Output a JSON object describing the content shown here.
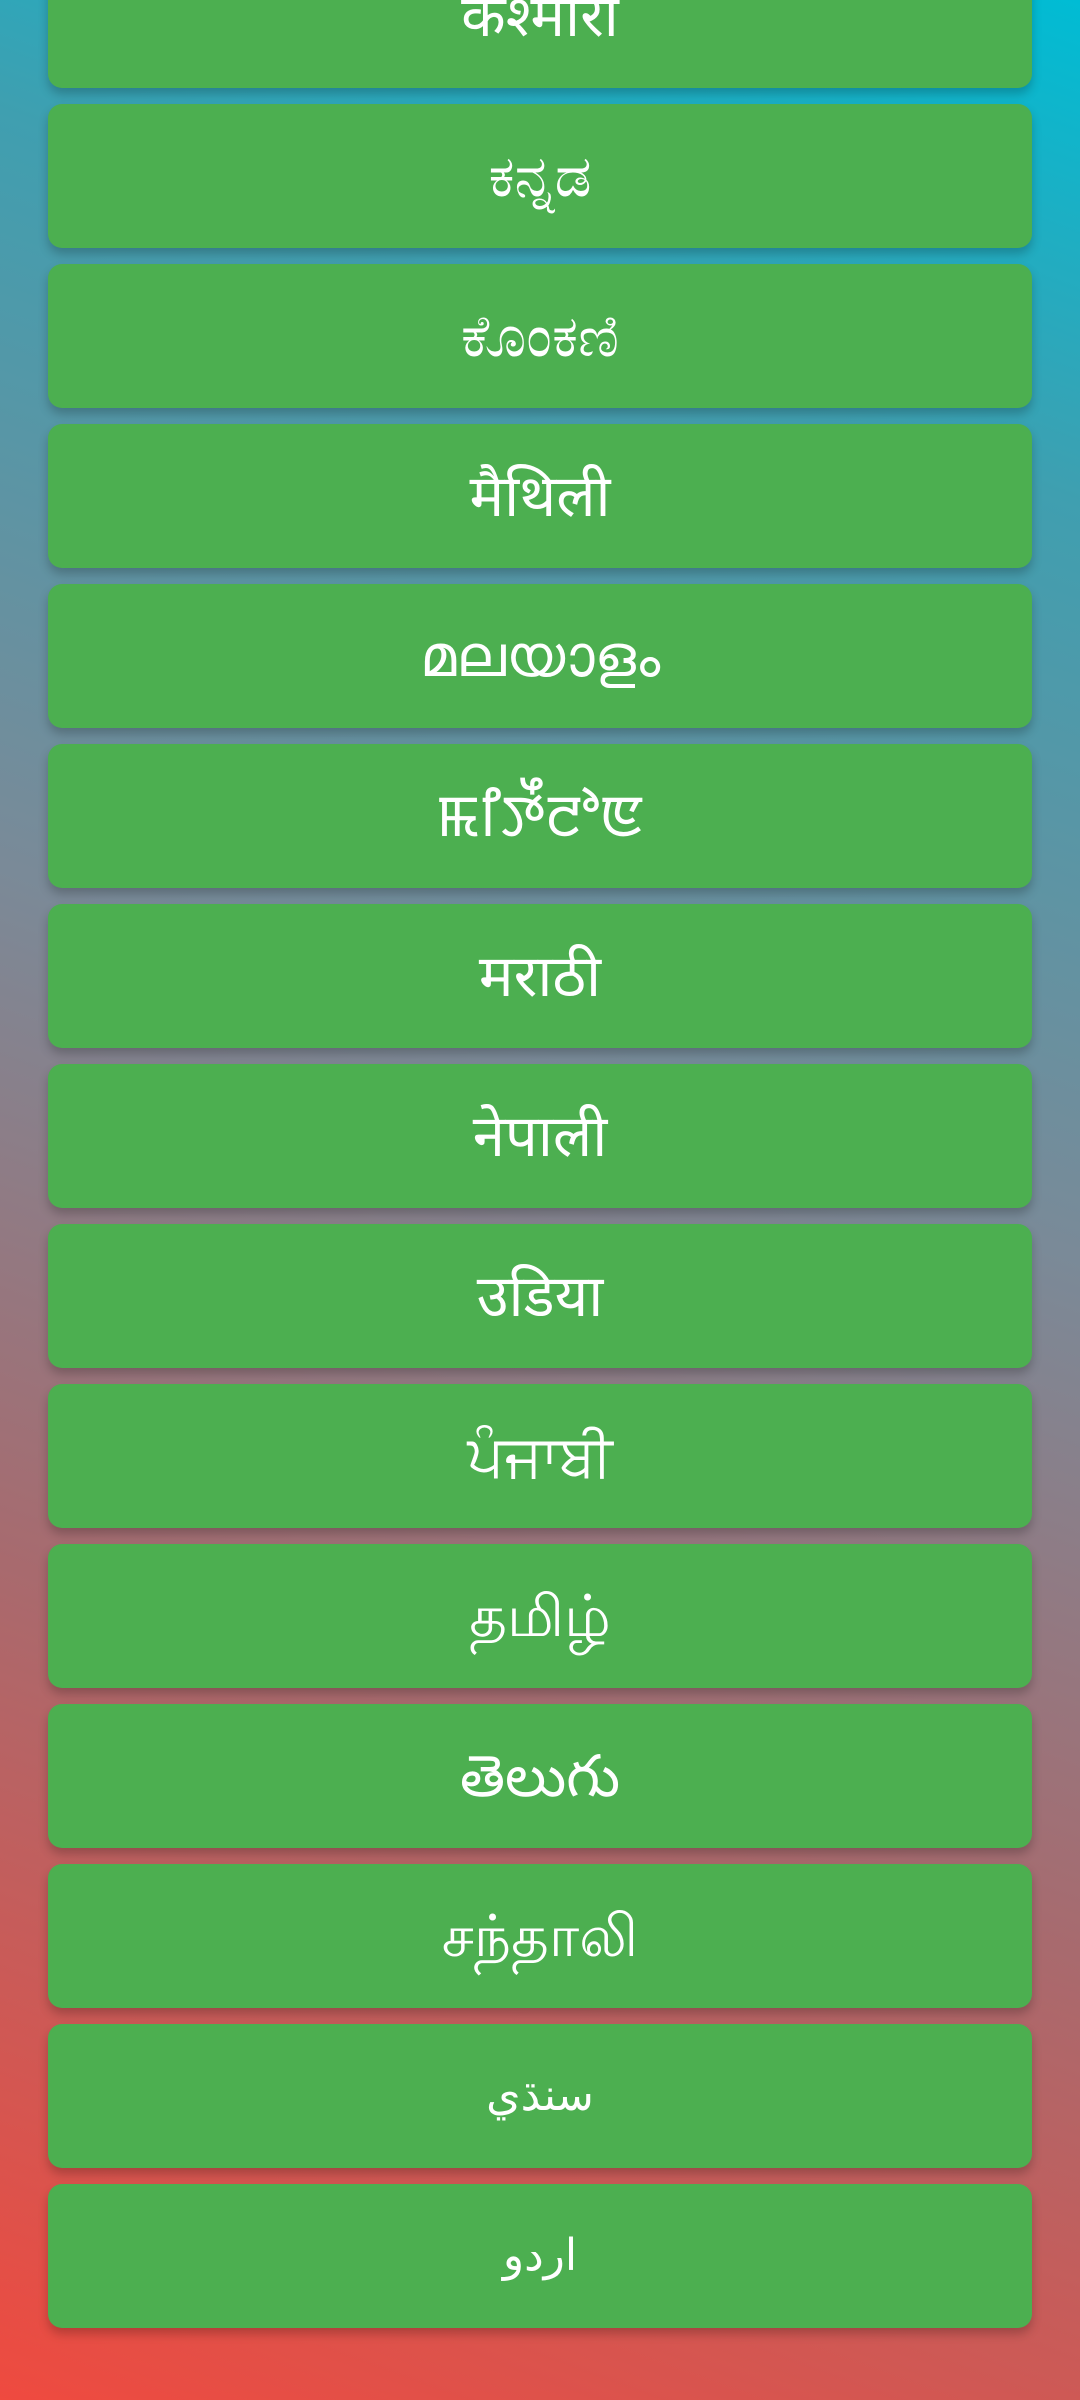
{
  "languages": [
    {
      "label": "कश्मीरी"
    },
    {
      "label": "ಕನ್ನಡ"
    },
    {
      "label": "ಕೊಂಕಣಿ"
    },
    {
      "label": "मैथिली"
    },
    {
      "label": "മലയാളം"
    },
    {
      "label": "ꯃꯤꯇꯩꯂꯣꯟ"
    },
    {
      "label": "मराठी"
    },
    {
      "label": "नेपाली"
    },
    {
      "label": "उडिया"
    },
    {
      "label": "ਪੰਜਾਬੀ"
    },
    {
      "label": "தமிழ்"
    },
    {
      "label": "తెలుగు"
    },
    {
      "label": "சந்தாலி"
    },
    {
      "label": "سنڌي"
    },
    {
      "label": "اردو"
    }
  ]
}
